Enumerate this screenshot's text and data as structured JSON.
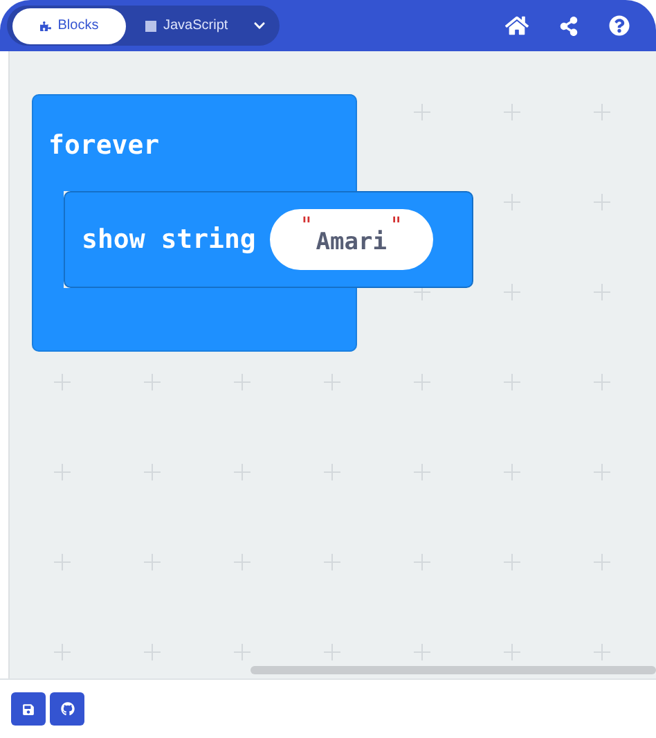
{
  "header": {
    "tabs": [
      {
        "label": "Blocks",
        "selected": true
      },
      {
        "label": "JavaScript",
        "selected": false
      }
    ]
  },
  "workspace": {
    "event_block": {
      "label": "forever",
      "statement": {
        "label": "show string",
        "open_quote": "\"",
        "value": "Amari",
        "close_quote": "\""
      }
    }
  }
}
